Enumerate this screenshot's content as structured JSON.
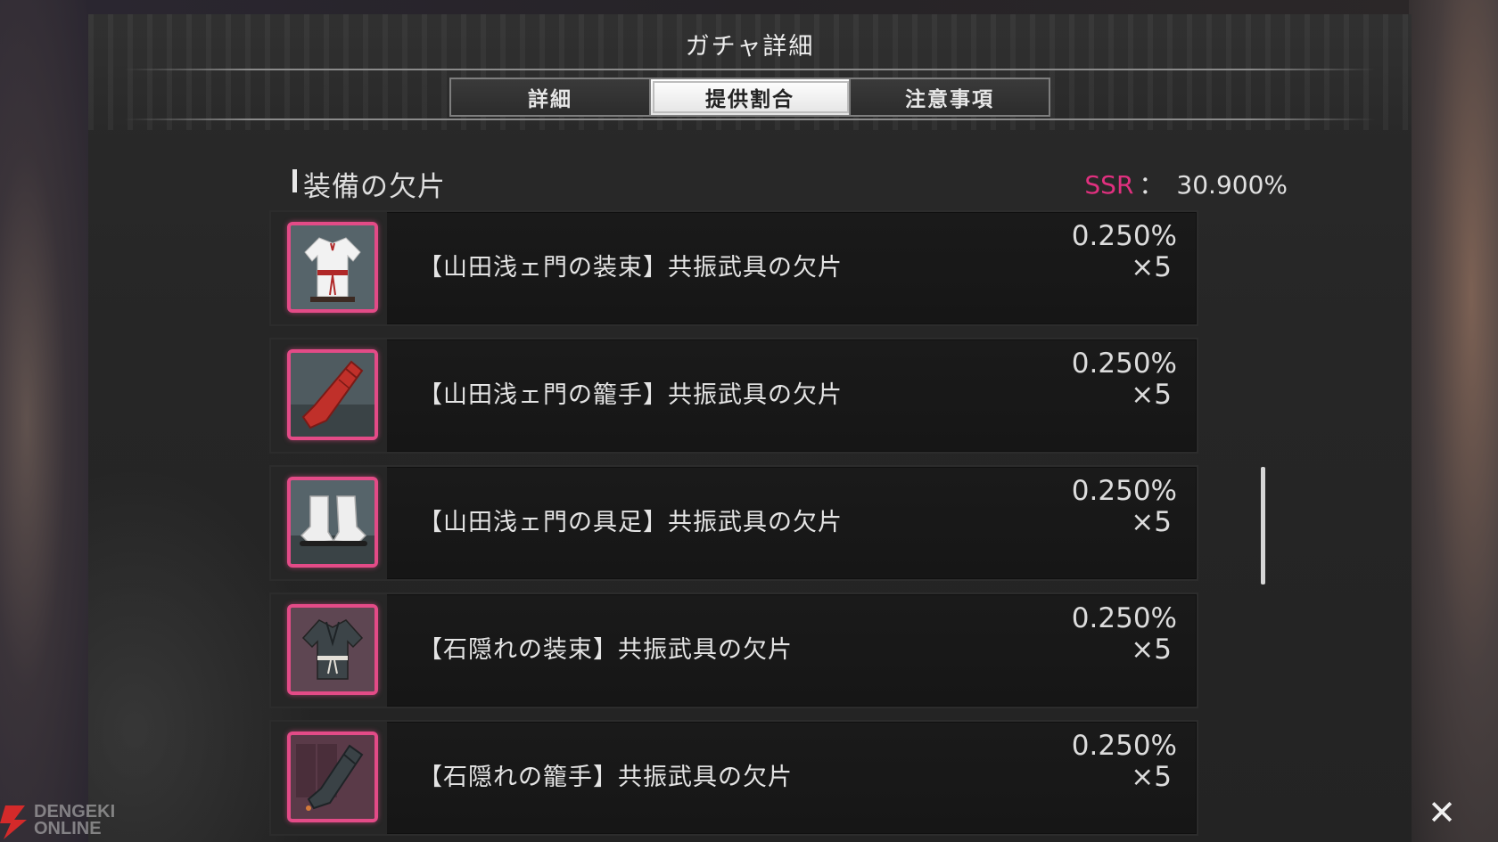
{
  "dialog": {
    "title": "ガチャ詳細",
    "tabs": [
      {
        "label": "詳細",
        "active": false
      },
      {
        "label": "提供割合",
        "active": true
      },
      {
        "label": "注意事項",
        "active": false
      }
    ]
  },
  "section": {
    "title": "装備の欠片",
    "rarity_label": "SSR",
    "rarity_separator": "：",
    "rarity_rate": "30.900%"
  },
  "items": [
    {
      "name": "【山田浅ェ門の装束】共振武具の欠片",
      "rate": "0.250%",
      "qty": "×5",
      "icon": "white-robe-icon"
    },
    {
      "name": "【山田浅ェ門の籠手】共振武具の欠片",
      "rate": "0.250%",
      "qty": "×5",
      "icon": "red-gauntlet-icon"
    },
    {
      "name": "【山田浅ェ門の具足】共振武具の欠片",
      "rate": "0.250%",
      "qty": "×5",
      "icon": "white-boots-icon"
    },
    {
      "name": "【石隠れの装束】共振武具の欠片",
      "rate": "0.250%",
      "qty": "×5",
      "icon": "dark-robe-icon"
    },
    {
      "name": "【石隠れの籠手】共振武具の欠片",
      "rate": "0.250%",
      "qty": "×5",
      "icon": "dark-gauntlet-icon"
    }
  ],
  "controls": {
    "close_symbol": "✕"
  },
  "watermark": {
    "line1": "DENGEKI",
    "line2": "ONLINE"
  },
  "colors": {
    "ssr_accent": "#e0307f",
    "thumb_border": "#e34b87"
  }
}
